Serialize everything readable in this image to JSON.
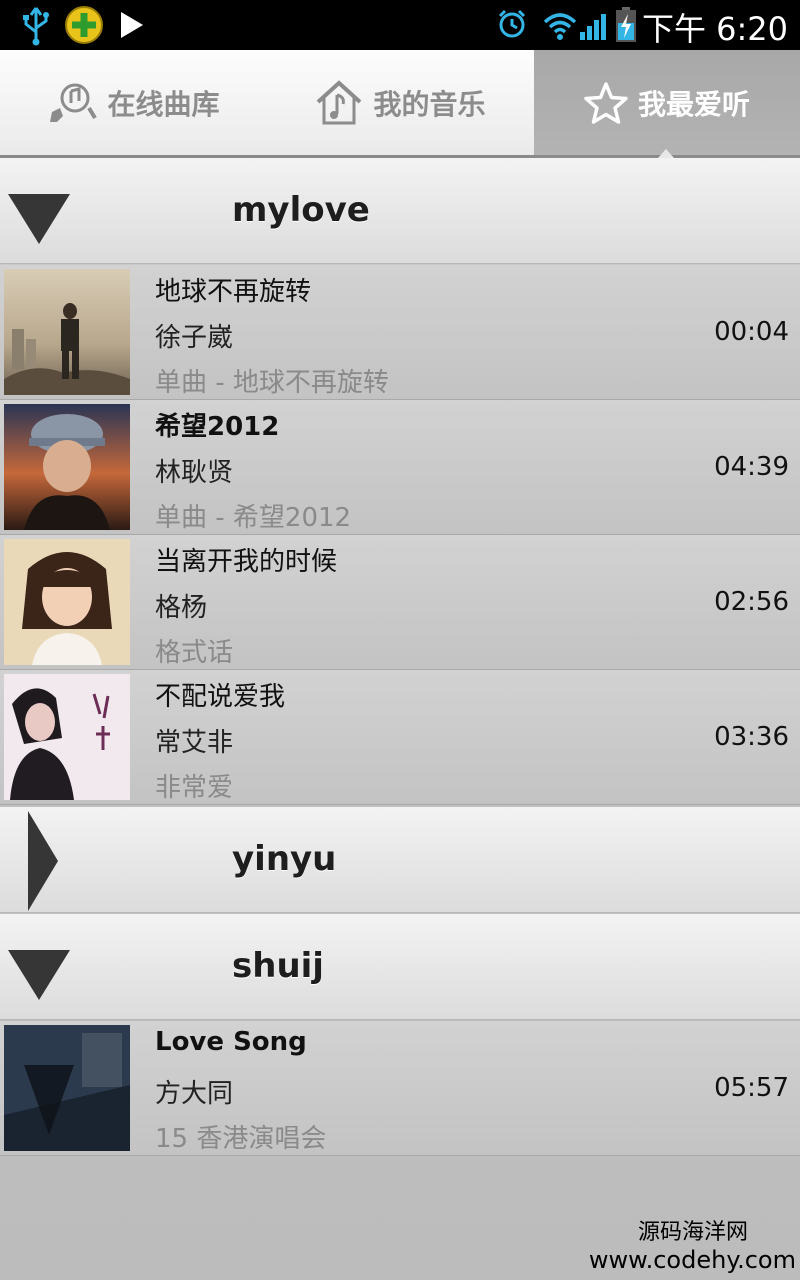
{
  "status_bar": {
    "time": "下午 6:20",
    "icons": [
      "usb-icon",
      "360-icon",
      "play-icon",
      "alarm-icon",
      "wifi-icon",
      "signal-icon",
      "battery-charging-icon"
    ]
  },
  "tabs": [
    {
      "label": "在线曲库",
      "icon": "online-library-icon",
      "active": false
    },
    {
      "label": "我的音乐",
      "icon": "my-music-icon",
      "active": false
    },
    {
      "label": "我最爱听",
      "icon": "star-icon",
      "active": true
    }
  ],
  "groups": [
    {
      "name": "mylove",
      "expanded": true,
      "songs": [
        {
          "title": "地球不再旋转",
          "artist": "徐子崴",
          "album": "单曲 - 地球不再旋转",
          "duration": "00:04"
        },
        {
          "title": "希望2012",
          "artist": "林耿贤",
          "album": "单曲 - 希望2012",
          "duration": "04:39"
        },
        {
          "title": "当离开我的时候",
          "artist": "格杨",
          "album": "格式话",
          "duration": "02:56"
        },
        {
          "title": "不配说爱我",
          "artist": "常艾非",
          "album": "非常爱",
          "duration": "03:36"
        }
      ]
    },
    {
      "name": "yinyu",
      "expanded": false,
      "songs": []
    },
    {
      "name": "shuij",
      "expanded": true,
      "songs": [
        {
          "title": "Love Song",
          "artist": "方大同",
          "album": "15 香港演唱会",
          "duration": "05:57"
        }
      ]
    }
  ],
  "watermark": {
    "line1": "源码海洋网",
    "line2": "www.codehy.com"
  }
}
